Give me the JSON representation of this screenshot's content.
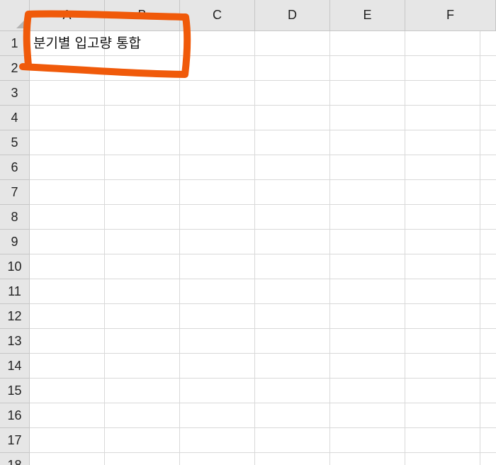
{
  "columns": [
    "A",
    "B",
    "C",
    "D",
    "E",
    "F"
  ],
  "rows": [
    "1",
    "2",
    "3",
    "4",
    "5",
    "6",
    "7",
    "8",
    "9",
    "10",
    "11",
    "12",
    "13",
    "14",
    "15",
    "16",
    "17",
    "18"
  ],
  "cells": {
    "A1": "분기별 입고량 통합"
  },
  "annotation": {
    "type": "hand-drawn-rectangle",
    "color": "#f05a0a"
  }
}
